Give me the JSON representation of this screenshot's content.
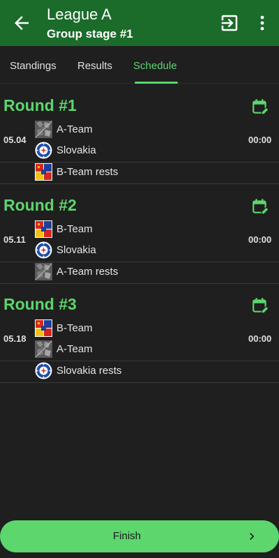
{
  "header": {
    "title": "League A",
    "subtitle": "Group stage #1"
  },
  "tabs": [
    {
      "label": "Standings"
    },
    {
      "label": "Results"
    },
    {
      "label": "Schedule",
      "active": true
    }
  ],
  "rounds": [
    {
      "title": "Round #1",
      "date": "05.04",
      "time": "00:00",
      "home": "A-Team",
      "away": "Slovakia",
      "rest": "B-Team rests"
    },
    {
      "title": "Round #2",
      "date": "05.11",
      "time": "00:00",
      "home": "B-Team",
      "away": "Slovakia",
      "rest": "A-Team rests"
    },
    {
      "title": "Round #3",
      "date": "05.18",
      "time": "00:00",
      "home": "B-Team",
      "away": "A-Team",
      "rest": "Slovakia rests"
    }
  ],
  "footer": {
    "finish_label": "Finish"
  },
  "colors": {
    "appbar": "#1b6b2a",
    "accent": "#5cd66d",
    "background": "#1f1f1f"
  },
  "icons": {
    "back": "arrow-left-icon",
    "exit": "exit-icon",
    "more": "more-vertical-icon",
    "calendar": "calendar-edit-icon",
    "next": "chevron-right-icon"
  }
}
